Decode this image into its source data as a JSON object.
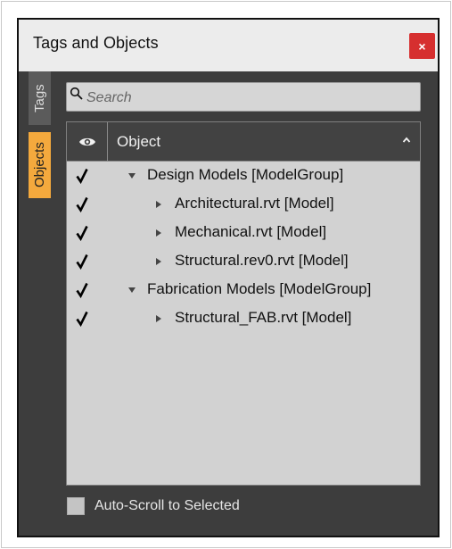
{
  "window": {
    "title": "Tags and Objects",
    "close_glyph": "×",
    "accent_color": "#f4a93d",
    "close_color": "#d62f2f"
  },
  "tabs": [
    {
      "label": "Tags",
      "active": false
    },
    {
      "label": "Objects",
      "active": true
    }
  ],
  "search": {
    "placeholder": "Search",
    "value": ""
  },
  "tree": {
    "header": {
      "visibility_icon": "eye-icon",
      "column_label": "Object",
      "sort_icon": "sort-up-icon"
    },
    "rows": [
      {
        "label": "Design Models [ModelGroup]",
        "checked": true,
        "level": 0,
        "expanded": true
      },
      {
        "label": "Architectural.rvt [Model]",
        "checked": true,
        "level": 1,
        "expanded": false
      },
      {
        "label": "Mechanical.rvt [Model]",
        "checked": true,
        "level": 1,
        "expanded": false
      },
      {
        "label": "Structural.rev0.rvt [Model]",
        "checked": true,
        "level": 1,
        "expanded": false
      },
      {
        "label": "Fabrication Models [ModelGroup]",
        "checked": true,
        "level": 0,
        "expanded": true
      },
      {
        "label": "Structural_FAB.rvt [Model]",
        "checked": true,
        "level": 1,
        "expanded": false
      }
    ]
  },
  "footer": {
    "auto_scroll_label": "Auto-Scroll to Selected",
    "auto_scroll_checked": false
  }
}
